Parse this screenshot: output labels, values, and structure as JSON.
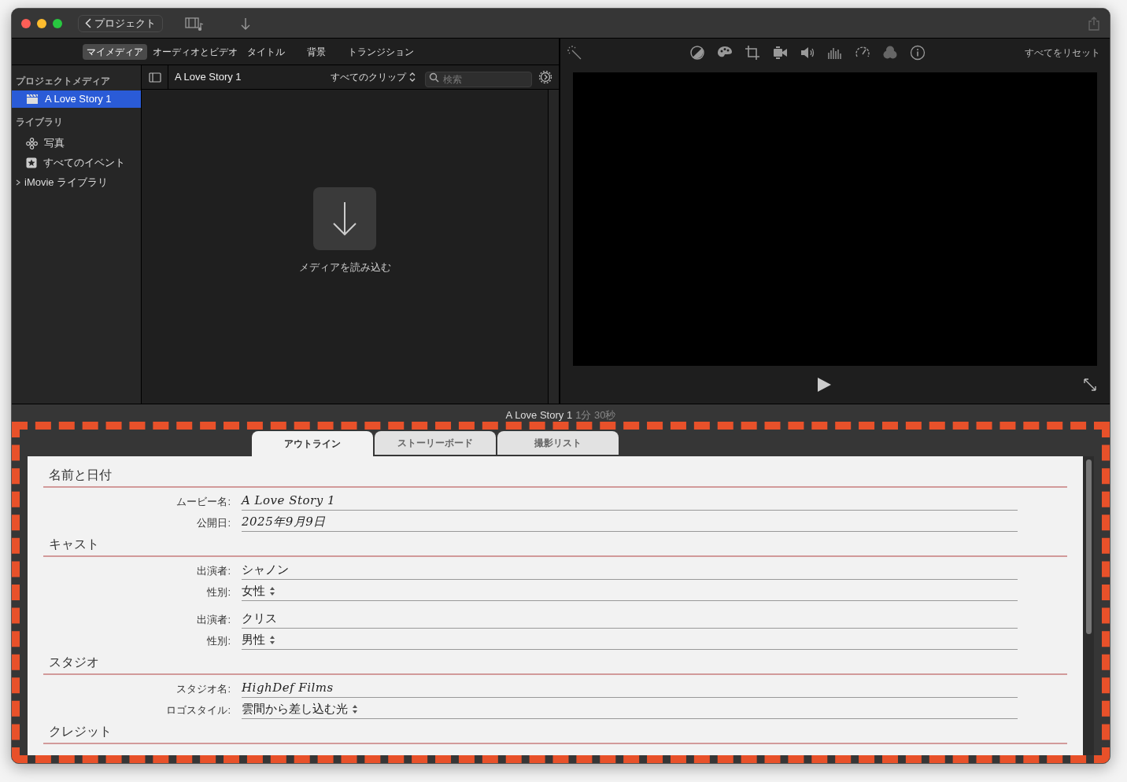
{
  "toolbar": {
    "back_button": "プロジェクト"
  },
  "media_tabs": [
    {
      "label": "マイメディア",
      "selected": true
    },
    {
      "label": "オーディオとビデオ",
      "selected": false
    },
    {
      "label": "タイトル",
      "selected": false
    },
    {
      "label": "背景",
      "selected": false
    },
    {
      "label": "トランジション",
      "selected": false
    }
  ],
  "sidebar": {
    "sections": [
      {
        "title": "プロジェクトメディア",
        "items": [
          {
            "label": "A Love Story 1",
            "kind": "project",
            "selected": true
          }
        ]
      },
      {
        "title": "ライブラリ",
        "items": [
          {
            "label": "写真",
            "kind": "photos",
            "selected": false
          },
          {
            "label": "すべてのイベント",
            "kind": "events",
            "selected": false
          },
          {
            "label": "iMovie ライブラリ",
            "kind": "library",
            "selected": false,
            "expanded": false
          }
        ]
      }
    ]
  },
  "browser": {
    "title": "A Love Story 1",
    "filter": "すべてのクリップ",
    "search": {
      "placeholder": "検索"
    },
    "import_label": "メディアを読み込む"
  },
  "viewer": {
    "reset_button": "すべてをリセット"
  },
  "project_bar": {
    "title": "A Love Story 1",
    "duration": "1分 30秒"
  },
  "drop_highlight": true,
  "outline_tabs": [
    {
      "label": "アウトライン",
      "selected": true
    },
    {
      "label": "ストーリーボード",
      "selected": false
    },
    {
      "label": "撮影リスト",
      "selected": false
    }
  ],
  "sections": [
    {
      "title": "名前と日付",
      "fields": [
        {
          "label": "ムービー名:",
          "value": "A Love Story 1",
          "kind": "handwriting"
        },
        {
          "label": "公開日:",
          "value": "2025年9月9日",
          "kind": "handwriting"
        }
      ]
    },
    {
      "title": "キャスト",
      "fields": [
        {
          "label": "出演者:",
          "value": "シャノン",
          "kind": "text"
        },
        {
          "label": "性別:",
          "value": "女性",
          "kind": "popup"
        },
        {
          "label": "出演者:",
          "value": "クリス",
          "kind": "text"
        },
        {
          "label": "性別:",
          "value": "男性",
          "kind": "popup"
        }
      ]
    },
    {
      "title": "スタジオ",
      "fields": [
        {
          "label": "スタジオ名:",
          "value": "HighDef Films",
          "kind": "handwriting"
        },
        {
          "label": "ロゴスタイル:",
          "value": "雲間から差し込む光",
          "kind": "popup"
        }
      ]
    },
    {
      "title": "クレジット"
    }
  ]
}
